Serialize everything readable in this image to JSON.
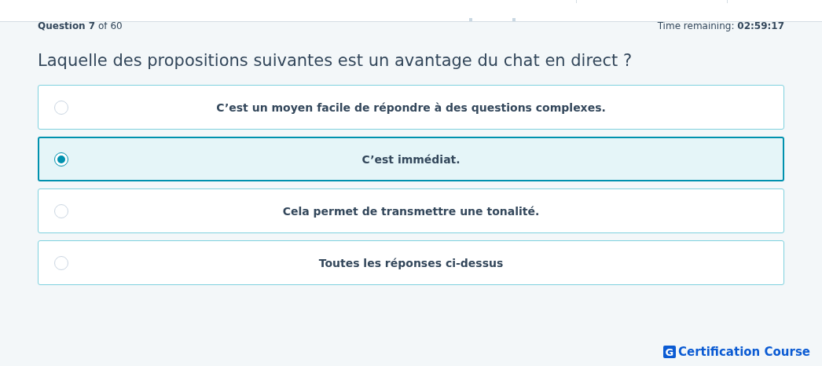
{
  "progress": {
    "counter": "**Question 7** of 60",
    "timer": "Time remaining: **02:59:17**"
  },
  "question": "Laquelle des propositions suivantes est un avantage du chat en direct ?",
  "options": [
    {
      "label": "C’est un moyen facile de répondre à des questions complexes.",
      "selected": false
    },
    {
      "label": "C’est immédiat.",
      "selected": true
    },
    {
      "label": "Cela permet de transmettre une tonalité.",
      "selected": false
    },
    {
      "label": "Toutes les réponses ci-dessus",
      "selected": false
    }
  ],
  "brand": {
    "mark": "G",
    "name": "Certification Course"
  }
}
